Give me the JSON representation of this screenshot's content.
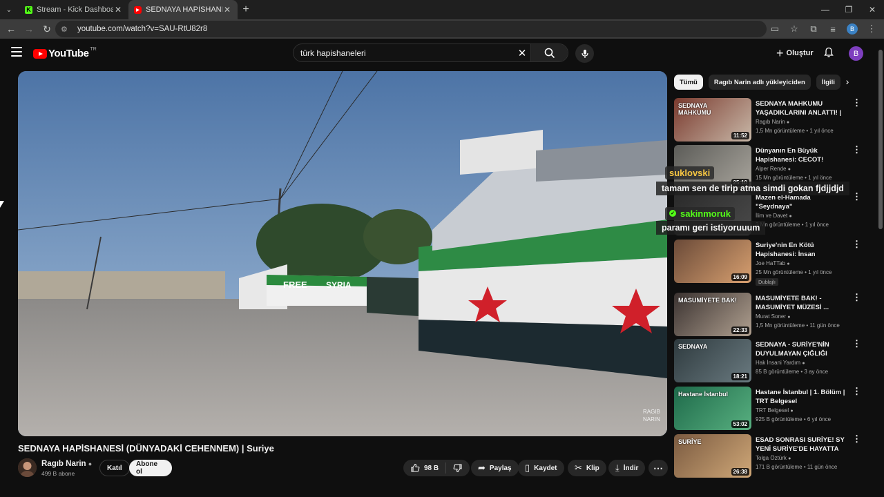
{
  "browser": {
    "tabs": [
      {
        "title": "Stream - Kick Dashboard",
        "favicon": "kick-icon",
        "active": false
      },
      {
        "title": "SEDNAYA HAPİSHANESİ (DÜNYA",
        "favicon": "youtube-icon",
        "active": true
      }
    ],
    "url": "youtube.com/watch?v=SAU-RtU82r8",
    "profile_initial": "B"
  },
  "header": {
    "logo_text": "YouTube",
    "region": "TR",
    "search_value": "türk hapishaneleri",
    "create_label": "Oluştur",
    "avatar_initial": "B"
  },
  "video": {
    "title": "SEDNAYA HAPİSHANESİ (DÜNYADAKİ CEHENNEM) | Suriye",
    "channel": "Ragıb Narin",
    "subscribers": "499 B abone",
    "join_label": "Katıl",
    "subscribe_label": "Abone ol",
    "likes": "98 B",
    "share_label": "Paylaş",
    "save_label": "Kaydet",
    "clip_label": "Klip",
    "download_label": "İndir",
    "player_watermark_1": "RAGIB",
    "player_watermark_2": "NARIN",
    "scene_text_free": "FREE",
    "scene_text_syria": "SYRIA"
  },
  "chips": [
    "Tümü",
    "Ragıb Narin adlı yükleyiciden",
    "İlgili"
  ],
  "recommendations": [
    {
      "title": "SEDNAYA MAHKUMU YAŞADIKLARINI ANLATTI! | ...",
      "channel": "Ragıb Narin",
      "meta": "1,5 Mn görüntüleme • 1 yıl önce",
      "duration": "11:52",
      "thumb_text": "SEDNAYA MAHKUMU",
      "colors": [
        "#7a3a2e",
        "#c8b8a8"
      ]
    },
    {
      "title": "Dünyanın En Büyük Hapishanesi: CECOT! Buraya ...",
      "channel": "Alper Rende",
      "meta": "15 Mn görüntüleme • 1 yıl önce",
      "duration": "25:10",
      "thumb_text": "",
      "colors": [
        "#5c5c58",
        "#a8a49c"
      ]
    },
    {
      "title": "Mazen el-Hamada \"Seydnaya\" Hapishanesindeki İşkenceleri ...",
      "channel": "İlim ve Davet",
      "meta": "2 Mn görüntüleme • 1 yıl önce",
      "duration": "",
      "thumb_text": "",
      "colors": [
        "#2a2a2a",
        "#4a4a4a"
      ]
    },
    {
      "title": "Suriye'nin En Kötü Hapishanesi: İnsan Mezbahası",
      "channel": "Joe HaTTab",
      "meta": "25 Mn görüntüleme • 1 yıl önce",
      "duration": "16:09",
      "badge": "Dublajlı",
      "thumb_text": "",
      "colors": [
        "#6a4a38",
        "#d8a070"
      ]
    },
    {
      "title": "MASUMİYETE BAK! - MASUMİYET MÜZESİ ...",
      "channel": "Murat Soner",
      "meta": "1,5 Mn görüntüleme • 11 gün önce",
      "duration": "22:33",
      "thumb_text": "MASUMİYETE BAK!",
      "colors": [
        "#3a3230",
        "#b0a090"
      ]
    },
    {
      "title": "SEDNAYA - SURİYE'NİN DUYULMAYAN ÇIĞLIĞI",
      "channel": "Hak İnsani Yardım",
      "meta": "85 B görüntüleme • 3 ay önce",
      "duration": "18:21",
      "thumb_text": "SEDNAYA",
      "colors": [
        "#2e3a3e",
        "#6a7a80"
      ]
    },
    {
      "title": "Hastane İstanbul | 1. Bölüm | TRT Belgesel",
      "channel": "TRT Belgesel",
      "meta": "925 B görüntüleme • 6 yıl önce",
      "duration": "53:02",
      "thumb_text": "Hastane İstanbul",
      "colors": [
        "#1e6a4a",
        "#58b080"
      ]
    },
    {
      "title": "ESAD SONRASI SURİYE! SY YENİ SURİYE'DE HAYATTA KALMAK!",
      "channel": "Tolga Öztürk",
      "meta": "171 B görüntüleme • 11 gün önce",
      "duration": "26:38",
      "thumb_text": "SURİYE",
      "colors": [
        "#7a5a40",
        "#d0a878"
      ]
    }
  ],
  "chat_overlay": [
    {
      "user": "suklovski",
      "message": "tamam sen de tirip atma simdi gokan fjdjjdjd",
      "user_color": "#f5c542"
    },
    {
      "user": "sakinmoruk",
      "message": "paramı geri istiyoruuum",
      "user_color": "#53fc18"
    }
  ]
}
